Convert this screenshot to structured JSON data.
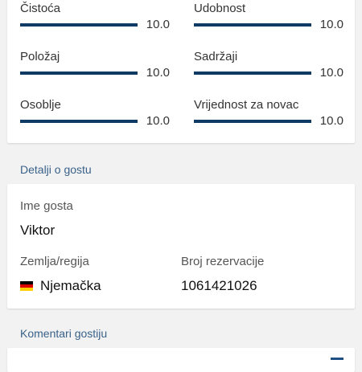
{
  "scores": [
    {
      "label": "Čistoća",
      "value": "10.0",
      "fraction": 1.0
    },
    {
      "label": "Udobnost",
      "value": "10.0",
      "fraction": 1.0
    },
    {
      "label": "Položaj",
      "value": "10.0",
      "fraction": 1.0
    },
    {
      "label": "Sadržaji",
      "value": "10.0",
      "fraction": 1.0
    },
    {
      "label": "Osoblje",
      "value": "10.0",
      "fraction": 1.0
    },
    {
      "label": "Vrijednost za novac",
      "value": "10.0",
      "fraction": 1.0
    }
  ],
  "guest_details": {
    "section_title": "Detalji o gostu",
    "name_label": "Ime gosta",
    "name_value": "Viktor",
    "country_label": "Zemlja/regija",
    "country_value": "Njemačka",
    "country_flag_colors": [
      "#000000",
      "#dd0000",
      "#ffce00"
    ],
    "booking_label": "Broj rezervacije",
    "booking_value": "1061421026"
  },
  "comments": {
    "section_title": "Komentari gostiju"
  },
  "colors": {
    "bar_fill": "#0f3a63",
    "section_title": "#39618a"
  }
}
